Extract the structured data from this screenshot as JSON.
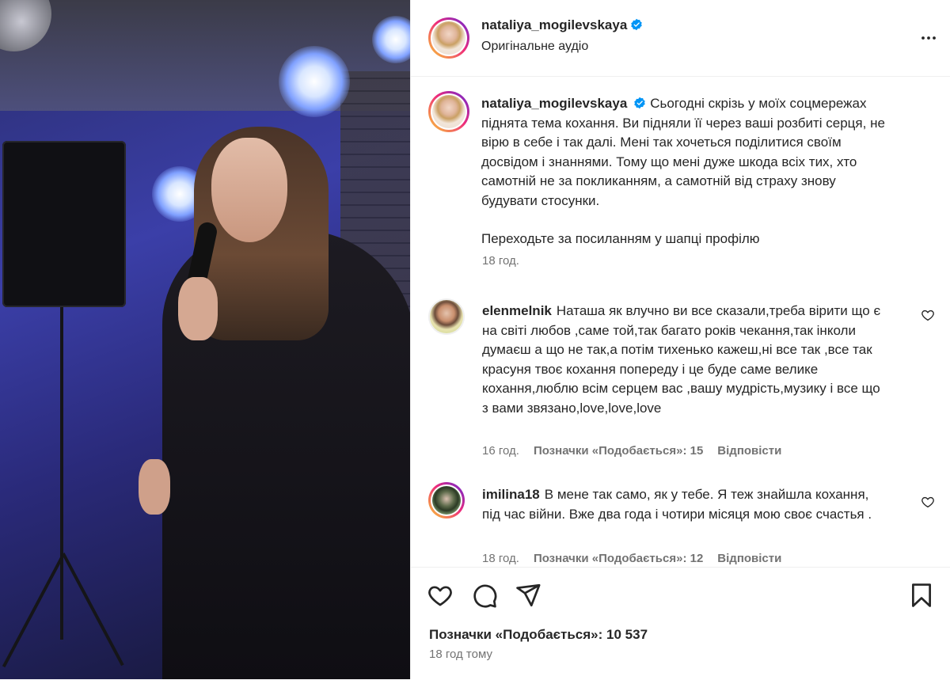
{
  "post": {
    "username": "nataliya_mogilevskaya",
    "audio": "Оригінальне аудіо",
    "caption": "Сьогодні скрізь у моїх соцмережах піднята тема кохання. Ви підняли її через ваші розбиті серця, не вірю в себе і так далі. Мені так хочеться поділитися своїм досвідом і знаннями. Тому що мені дуже шкода всіх тих, хто самотній не за покликанням, а самотній від страху знову будувати стосунки.",
    "caption_link_line": "Переходьте за посиланням у шапці профілю",
    "caption_time": "18 год.",
    "likes": "Позначки «Подобається»: 10 537",
    "posted_ago": "18 год тому"
  },
  "comments": [
    {
      "username": "elenmelnik",
      "text": "Наташа як влучно ви все сказали,треба вірити що є на світі любов ,саме той,так багато років чекання,так інколи думаєш а що не так,а потім тихенько кажеш,ні все так ,все так красуня твоє кохання попереду і це буде саме велике кохання,люблю всім серцем вас ,вашу мудрість,музику і все що з вами звязано,love,love,love",
      "time": "16 год.",
      "likes": "Позначки «Подобається»: 15",
      "reply": "Відповісти"
    },
    {
      "username": "imilina18",
      "text": "В мене так само, як у тебе. Я теж знайшла кохання, під час війни. Вже два года і чотири місяця мою своє счастья .",
      "time": "18 год.",
      "likes": "Позначки «Подобається»: 12",
      "reply": "Відповісти"
    }
  ],
  "icons": {
    "more": "more-options-icon",
    "verified": "verified-badge-icon",
    "like": "heart-icon",
    "comment": "comment-icon",
    "share": "share-icon",
    "save": "bookmark-icon"
  },
  "colors": {
    "verified": "#0095f6",
    "muted": "#737373",
    "text": "#262626"
  }
}
